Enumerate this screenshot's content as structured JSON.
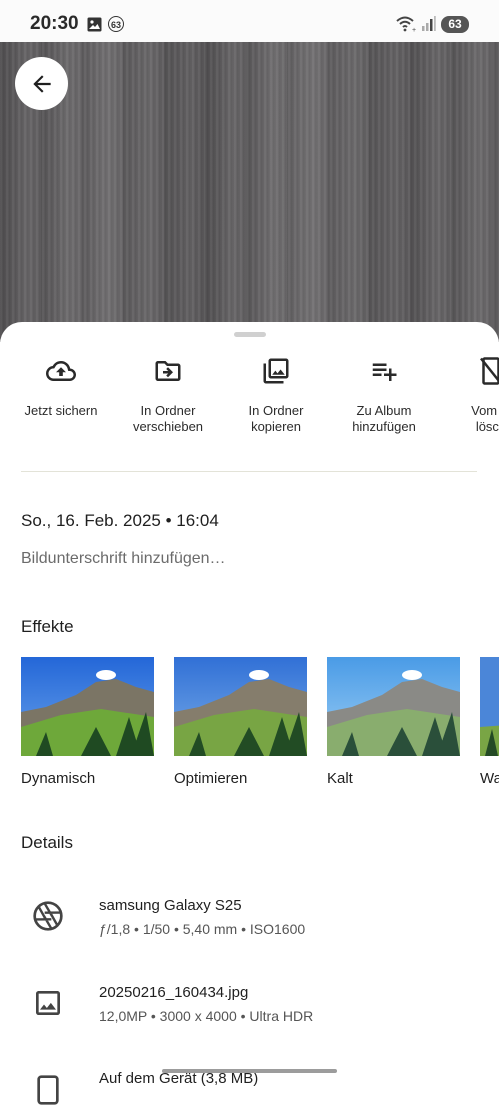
{
  "status_bar": {
    "time": "20:30",
    "notification_count": "63",
    "battery": "63",
    "icons": [
      "image-icon",
      "wifi-icon",
      "signal-icon"
    ]
  },
  "photo": {
    "description_icon": "arrow-back-icon"
  },
  "actions": [
    {
      "icon": "cloud-upload-icon",
      "label": "Jetzt sichern"
    },
    {
      "icon": "folder-move-icon",
      "label": "In Ordner verschieben"
    },
    {
      "icon": "copy-photos-icon",
      "label": "In Ordner kopieren"
    },
    {
      "icon": "playlist-add-icon",
      "label": "Zu Album hinzufügen"
    },
    {
      "icon": "phone-delete-icon",
      "label": "Vom G lösch"
    }
  ],
  "info": {
    "date": "So., 16. Feb. 2025 • 16:04",
    "caption_placeholder": "Bildunterschrift hinzufügen…"
  },
  "effects": {
    "title": "Effekte",
    "items": [
      {
        "label": "Dynamisch"
      },
      {
        "label": "Optimieren"
      },
      {
        "label": "Kalt"
      },
      {
        "label": "Wa"
      }
    ]
  },
  "details": {
    "title": "Details",
    "items": [
      {
        "icon": "camera-aperture-icon",
        "title": "samsung Galaxy S25",
        "subtitle": "ƒ/1,8  •  1/50  •  5,40 mm  •  ISO1600"
      },
      {
        "icon": "image-file-icon",
        "title": "20250216_160434.jpg",
        "subtitle": "12,0MP  •  3000 x 4000  •  Ultra HDR"
      },
      {
        "icon": "device-storage-icon",
        "title": "Auf dem Gerät (3,8 MB)",
        "subtitle": ""
      }
    ]
  },
  "colors": {
    "sky": "#3f7fd6",
    "meadow": "#6e9a3a",
    "accent_text": "#1f1f1f"
  }
}
